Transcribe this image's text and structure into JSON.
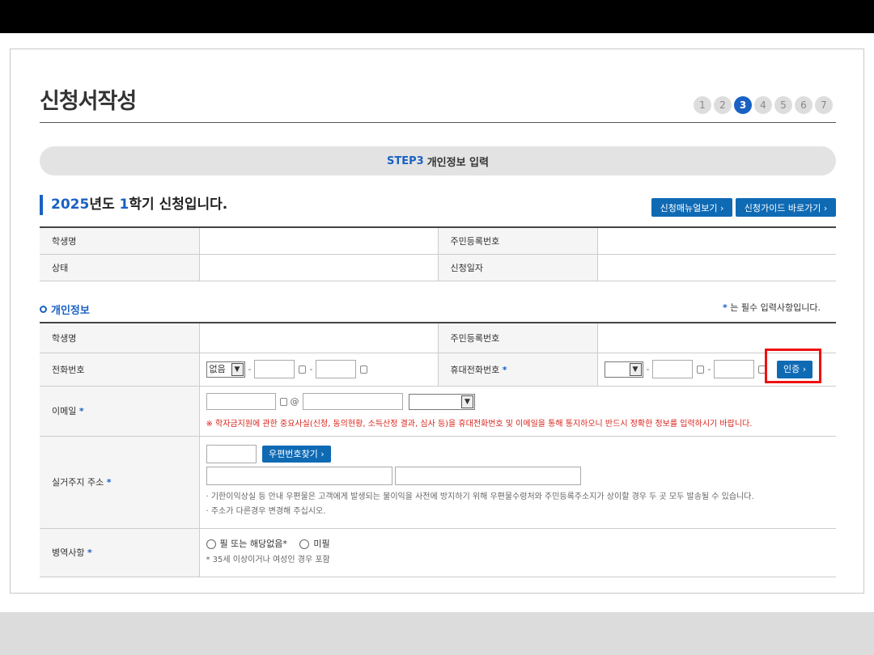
{
  "page": {
    "title": "신청서작성",
    "steps": [
      "1",
      "2",
      "3",
      "4",
      "5",
      "6",
      "7"
    ],
    "active_step": "3"
  },
  "banner": {
    "step": "STEP3",
    "label": "개인정보 입력"
  },
  "semester": {
    "year": "2025",
    "year_suffix": "년도 ",
    "term": "1",
    "term_suffix": "학기 신청입니다."
  },
  "buttons": {
    "manual": "신청매뉴얼보기 ›",
    "guide": "신청가이드 바로가기 ›"
  },
  "info_table": {
    "student_name": "학생명",
    "resident_no": "주민등록번호",
    "status": "상태",
    "apply_date": "신청일자"
  },
  "personal": {
    "section_title": "개인정보",
    "required_star": "*",
    "required_note": " 는 필수 입력사항입니다.",
    "student_name": "학생명",
    "resident_no": "주민등록번호",
    "phone_label": "전화번호",
    "phone_select": "없음",
    "mobile_label": "휴대전화번호",
    "auth_button": "인증 ›",
    "email_label": "이메일",
    "email_at": "@",
    "email_warning": "※ 학자금지원에 관한 중요사실(신청, 동의현황, 소득산정 결과, 심사 등)을 휴대전화번호 및 이메일을 통해 통지하오니 반드시 정확한 정보를 입력하시기 바랍니다.",
    "address_label": "실거주지 주소",
    "zip_button": "우편번호찾기 ›",
    "address_note1": "· 기한이익상실 등 안내 우편물은 고객에게 발생되는 불이익을 사전에 방지하기 위해 우편물수령처와 주민등록주소지가 상이할 경우 두 곳 모두 발송될 수 있습니다.",
    "address_note2": "· 주소가 다른경우 변경해 주십시오.",
    "military_label": "병역사항",
    "military_opt1": "필 또는 해당없음*",
    "military_opt2": "미필",
    "military_note": "* 35세 이상이거나 여성인 경우 포함"
  },
  "colors": {
    "accent": "#1a61c4",
    "button": "#0f6ab4",
    "warning": "#d9231a",
    "highlight": "#ee1111"
  }
}
